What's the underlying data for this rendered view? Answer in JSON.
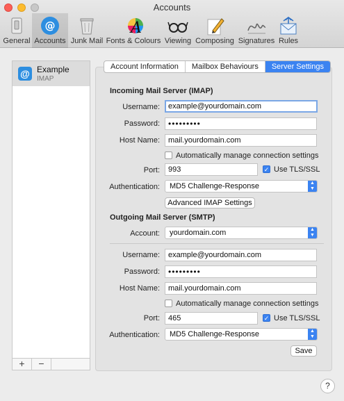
{
  "window": {
    "title": "Accounts"
  },
  "toolbar": {
    "items": [
      {
        "label": "General",
        "icon": "switch-icon"
      },
      {
        "label": "Accounts",
        "icon": "at-sign-icon"
      },
      {
        "label": "Junk Mail",
        "icon": "trash-bin-icon"
      },
      {
        "label": "Fonts & Colours",
        "icon": "color-font-icon"
      },
      {
        "label": "Viewing",
        "icon": "glasses-icon"
      },
      {
        "label": "Composing",
        "icon": "pencil-icon"
      },
      {
        "label": "Signatures",
        "icon": "signature-icon"
      },
      {
        "label": "Rules",
        "icon": "rules-envelope-icon"
      }
    ],
    "selected": "Accounts"
  },
  "sidebar": {
    "accounts": [
      {
        "name": "Example",
        "type": "IMAP"
      }
    ],
    "add_label": "+",
    "remove_label": "−"
  },
  "tabs": {
    "items": [
      "Account Information",
      "Mailbox Behaviours",
      "Server Settings"
    ],
    "active": "Server Settings"
  },
  "incoming": {
    "title": "Incoming Mail Server (IMAP)",
    "username_label": "Username:",
    "username": "example@yourdomain.com",
    "password_label": "Password:",
    "password": "•••••••••",
    "host_label": "Host Name:",
    "host": "mail.yourdomain.com",
    "auto_manage_label": "Automatically manage connection settings",
    "auto_manage": false,
    "port_label": "Port:",
    "port": "993",
    "tls_label": "Use TLS/SSL",
    "tls": true,
    "auth_label": "Authentication:",
    "auth": "MD5 Challenge-Response",
    "advanced_label": "Advanced IMAP Settings"
  },
  "outgoing": {
    "title": "Outgoing Mail Server (SMTP)",
    "account_label": "Account:",
    "account": "yourdomain.com",
    "username_label": "Username:",
    "username": "example@yourdomain.com",
    "password_label": "Password:",
    "password": "•••••••••",
    "host_label": "Host Name:",
    "host": "mail.yourdomain.com",
    "auto_manage_label": "Automatically manage connection settings",
    "auto_manage": false,
    "port_label": "Port:",
    "port": "465",
    "tls_label": "Use TLS/SSL",
    "tls": true,
    "auth_label": "Authentication:",
    "auth": "MD5 Challenge-Response"
  },
  "save_label": "Save",
  "help_label": "?",
  "colors": {
    "accent": "#3b83f1",
    "account_icon": "#2d8ee0"
  }
}
